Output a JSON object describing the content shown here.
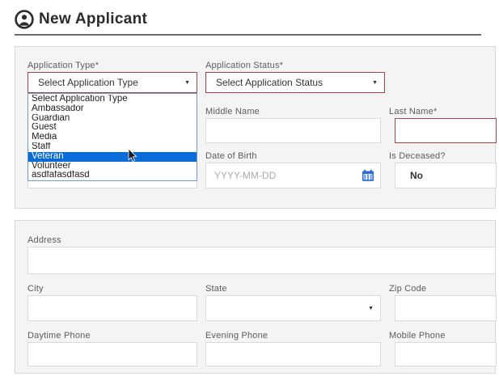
{
  "header": {
    "title": "New Applicant"
  },
  "colors": {
    "accent_required": "#a94442",
    "selection_blue": "#0a6cd6",
    "calendar_blue": "#2e6bd0",
    "card_bg": "#f4f4f4"
  },
  "icons": {
    "dropdown_arrow": "▼",
    "person": "person-icon",
    "calendar": "calendar-icon",
    "mouse_cursor": "mouse-cursor"
  },
  "form": {
    "application_type": {
      "label": "Application Type*",
      "value": "Select Application Type"
    },
    "application_status": {
      "label": "Application Status*",
      "value": "Select Application Status"
    },
    "middle_name": {
      "label": "Middle Name",
      "value": ""
    },
    "last_name": {
      "label": "Last Name*",
      "value": ""
    },
    "date_of_birth": {
      "label": "Date of Birth",
      "placeholder": "YYYY-MM-DD",
      "value": ""
    },
    "is_deceased": {
      "label": "Is Deceased?",
      "value": "No"
    }
  },
  "application_type_dropdown": {
    "options": [
      "Select Application Type",
      "Ambassador",
      "Guardian",
      "Guest",
      "Media",
      "Staff",
      "Veteran",
      "Volunteer",
      "asdfafasdfasd"
    ],
    "highlighted": "Veteran",
    "highlighted_index": 6
  },
  "address_section": {
    "address": {
      "label": "Address",
      "value": ""
    },
    "city": {
      "label": "City",
      "value": ""
    },
    "state": {
      "label": "State",
      "value": ""
    },
    "zip_code": {
      "label": "Zip Code",
      "value": ""
    },
    "daytime_phone": {
      "label": "Daytime Phone",
      "value": ""
    },
    "evening_phone": {
      "label": "Evening Phone",
      "value": ""
    },
    "mobile_phone": {
      "label": "Mobile Phone",
      "value": ""
    }
  }
}
